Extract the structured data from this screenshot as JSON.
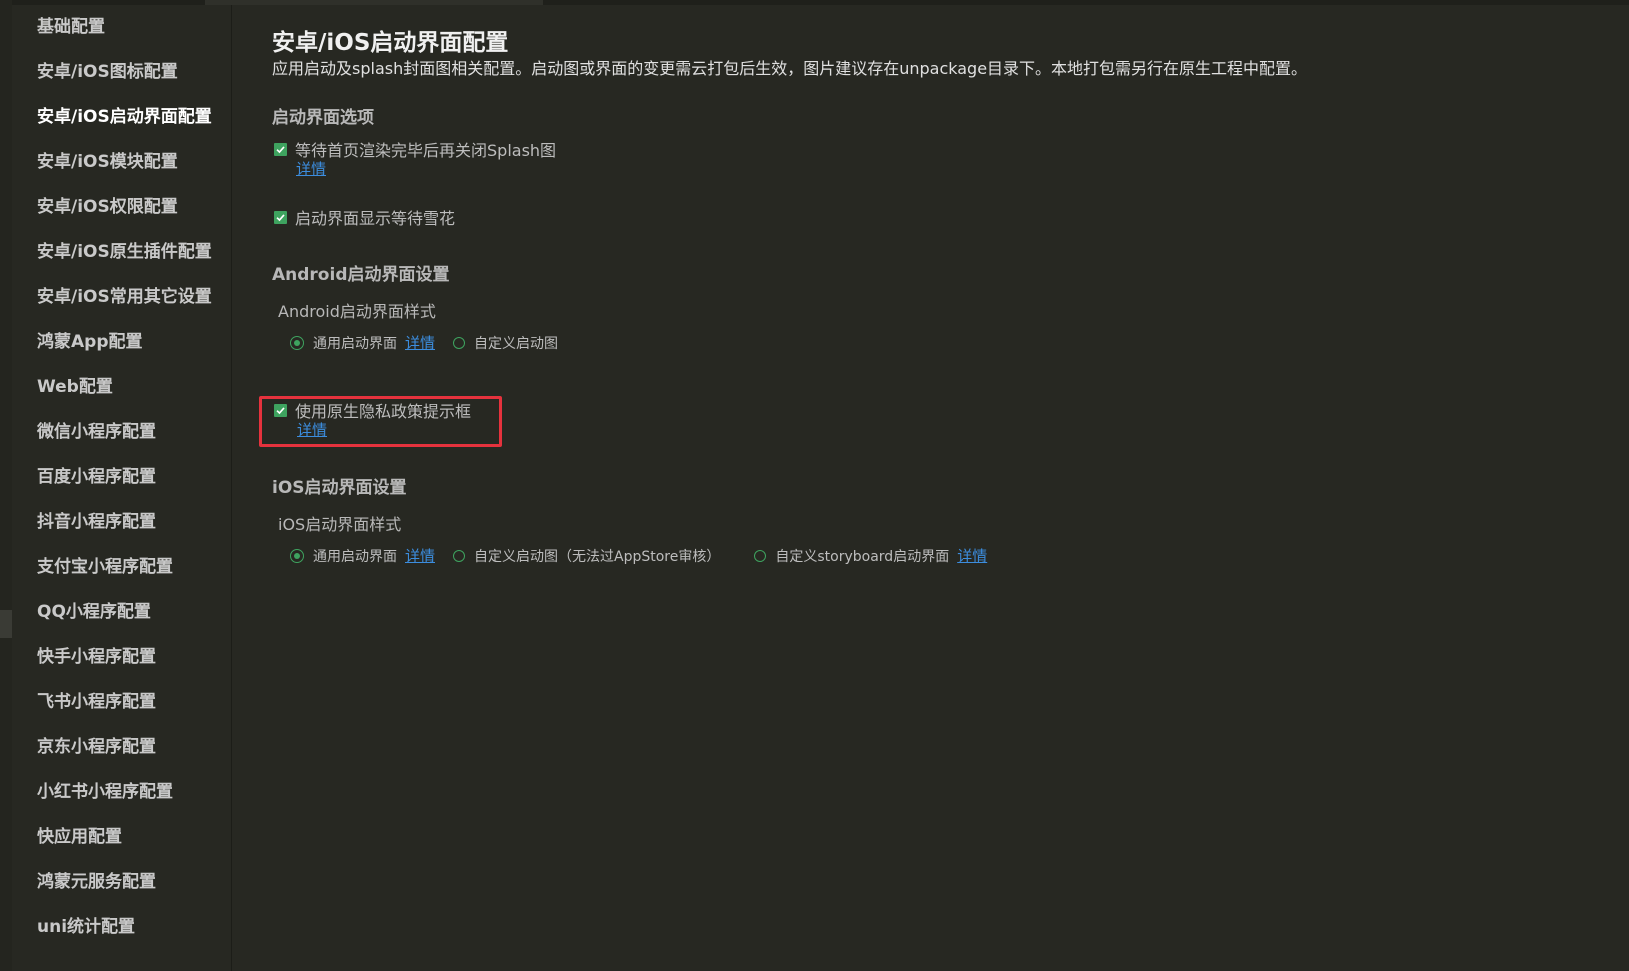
{
  "sidebar": {
    "items": [
      {
        "label": "基础配置"
      },
      {
        "label": "安卓/iOS图标配置"
      },
      {
        "label": "安卓/iOS启动界面配置"
      },
      {
        "label": "安卓/iOS模块配置"
      },
      {
        "label": "安卓/iOS权限配置"
      },
      {
        "label": "安卓/iOS原生插件配置"
      },
      {
        "label": "安卓/iOS常用其它设置"
      },
      {
        "label": "鸿蒙App配置"
      },
      {
        "label": "Web配置"
      },
      {
        "label": "微信小程序配置"
      },
      {
        "label": "百度小程序配置"
      },
      {
        "label": "抖音小程序配置"
      },
      {
        "label": "支付宝小程序配置"
      },
      {
        "label": "QQ小程序配置"
      },
      {
        "label": "快手小程序配置"
      },
      {
        "label": "飞书小程序配置"
      },
      {
        "label": "京东小程序配置"
      },
      {
        "label": "小红书小程序配置"
      },
      {
        "label": "快应用配置"
      },
      {
        "label": "鸿蒙元服务配置"
      },
      {
        "label": "uni统计配置"
      }
    ],
    "active_index": 2
  },
  "main": {
    "title": "安卓/iOS启动界面配置",
    "description": "应用启动及splash封面图相关配置。启动图或界面的变更需云打包后生效，图片建议存在unpackage目录下。本地打包需另行在原生工程中配置。",
    "splash_options": {
      "title": "启动界面选项",
      "wait_render": {
        "label": "等待首页渲染完毕后再关闭Splash图",
        "checked": true,
        "detail": "详情"
      },
      "show_spinner": {
        "label": "启动界面显示等待雪花",
        "checked": true
      }
    },
    "android": {
      "title": "Android启动界面设置",
      "style_label": "Android启动界面样式",
      "options": [
        {
          "label": "通用启动界面",
          "selected": true,
          "detail": "详情"
        },
        {
          "label": "自定义启动图",
          "selected": false
        }
      ]
    },
    "privacy": {
      "label": "使用原生隐私政策提示框",
      "checked": true,
      "detail": "详情"
    },
    "ios": {
      "title": "iOS启动界面设置",
      "style_label": "iOS启动界面样式",
      "options": [
        {
          "label": "通用启动界面",
          "selected": true,
          "detail": "详情"
        },
        {
          "label": "自定义启动图（无法过AppStore审核）",
          "selected": false
        },
        {
          "label": "自定义storyboard启动界面",
          "selected": false,
          "detail": "详情"
        }
      ]
    }
  },
  "colors": {
    "background": "#272822",
    "accent_green": "#3ea35f",
    "link_blue": "#3c8dde",
    "highlight_red": "#e5323d"
  }
}
